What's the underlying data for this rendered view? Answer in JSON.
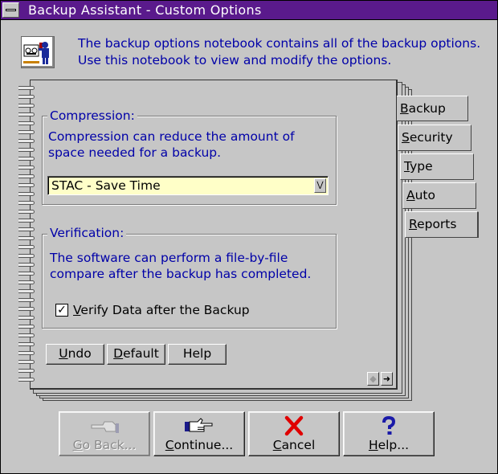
{
  "window": {
    "title": "Backup Assistant - Custom Options"
  },
  "header": {
    "icon": "backup-assistant-icon",
    "text": "The backup options notebook contains all of the backup options. Use this notebook to view and modify the options."
  },
  "compression": {
    "label": "Compression:",
    "description": "Compression can reduce the amount of space needed for a backup.",
    "selected": "STAC - Save Time"
  },
  "verification": {
    "label": "Verification:",
    "description": "The software can perform a file-by-file compare after the backup has completed.",
    "checkbox_prefix": "V",
    "checkbox_rest": "erify Data after the Backup",
    "checked": true
  },
  "page_buttons": {
    "undo_u": "U",
    "undo_rest": "ndo",
    "default_d": "D",
    "default_rest": "efault",
    "help": "Help"
  },
  "tabs": [
    {
      "label_u": "B",
      "label_rest": "ackup",
      "active": true
    },
    {
      "label_u": "S",
      "label_rest": "ecurity"
    },
    {
      "label_u": "T",
      "label_rest": "ype"
    },
    {
      "label_u": "A",
      "label_rest": "uto"
    },
    {
      "label_u": "R",
      "label_rest": "eports"
    }
  ],
  "buttons": {
    "go_back_u": "G",
    "go_back_rest": "o Back...",
    "continue_u": "C",
    "continue_rest": "ontinue...",
    "cancel_u": "C",
    "cancel_rest": "ancel",
    "help_u": "H",
    "help_rest": "elp..."
  },
  "colors": {
    "title_bar": "#5a1a8c",
    "info_text": "#0000a8",
    "combo_bg": "#ffffc8"
  }
}
